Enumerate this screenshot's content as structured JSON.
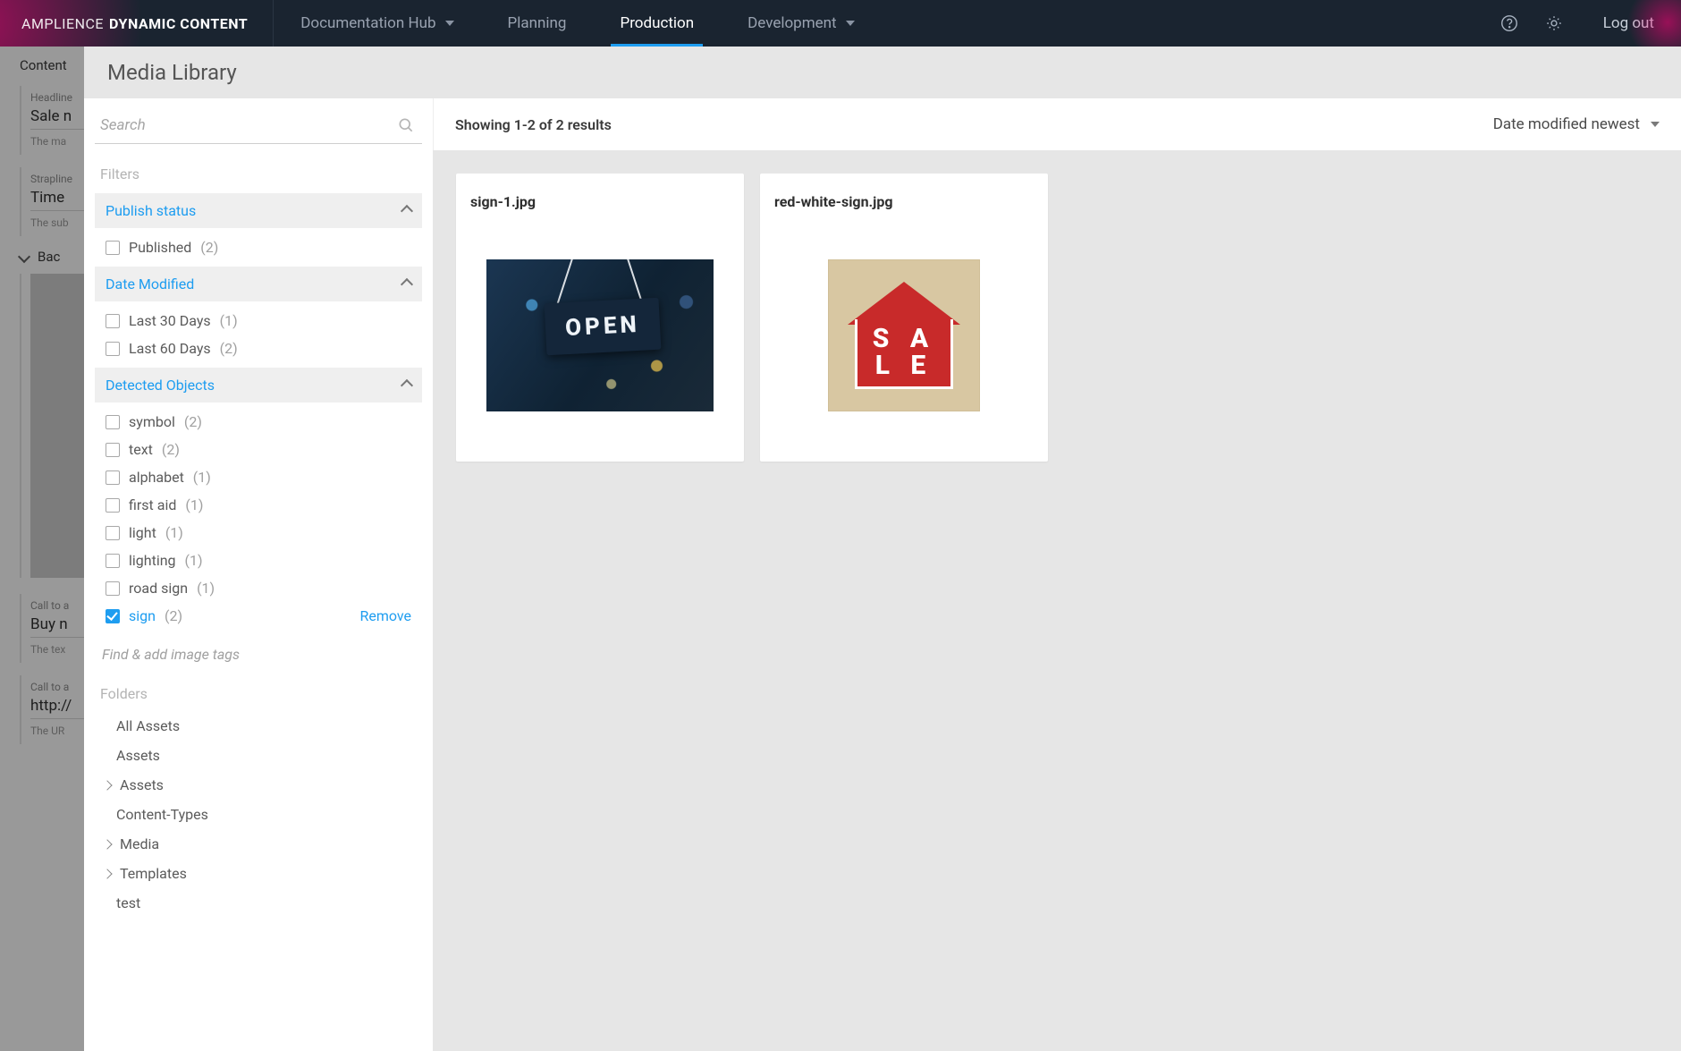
{
  "brand": {
    "part1": "AMPLIENCE",
    "part2": "DYNAMIC CONTENT"
  },
  "nav": {
    "docHub": "Documentation Hub",
    "planning": "Planning",
    "production": "Production",
    "development": "Development",
    "logout": "Log out"
  },
  "backdrop": {
    "contentTab": "Content",
    "headline": {
      "label": "Headline",
      "value": "Sale n",
      "help": "The ma"
    },
    "strap": {
      "label": "Strapline",
      "value": "Time",
      "help": "The sub"
    },
    "bgSection": "Bac",
    "cta": {
      "label": "Call to a",
      "value": "Buy n",
      "help": "The tex"
    },
    "ctaUrl": {
      "label": "Call to a",
      "value": "http://",
      "help": "The UR"
    }
  },
  "mlib": {
    "title": "Media Library",
    "searchPlaceholder": "Search",
    "filtersLabel": "Filters",
    "facets": {
      "publish": {
        "title": "Publish status",
        "options": [
          {
            "label": "Published",
            "count": "(2)"
          }
        ]
      },
      "date": {
        "title": "Date Modified",
        "options": [
          {
            "label": "Last 30 Days",
            "count": "(1)"
          },
          {
            "label": "Last 60 Days",
            "count": "(2)"
          }
        ]
      },
      "detected": {
        "title": "Detected Objects",
        "options": [
          {
            "label": "symbol",
            "count": "(2)"
          },
          {
            "label": "text",
            "count": "(2)"
          },
          {
            "label": "alphabet",
            "count": "(1)"
          },
          {
            "label": "first aid",
            "count": "(1)"
          },
          {
            "label": "light",
            "count": "(1)"
          },
          {
            "label": "lighting",
            "count": "(1)"
          },
          {
            "label": "road sign",
            "count": "(1)"
          },
          {
            "label": "sign",
            "count": "(2)",
            "checked": true
          }
        ],
        "remove": "Remove"
      }
    },
    "tagInputPlaceholder": "Find & add image tags",
    "foldersLabel": "Folders",
    "folders": [
      {
        "label": "All Assets",
        "expandable": false
      },
      {
        "label": "Assets",
        "expandable": false
      },
      {
        "label": "Assets",
        "expandable": true
      },
      {
        "label": "Content-Types",
        "expandable": false
      },
      {
        "label": "Media",
        "expandable": true
      },
      {
        "label": "Templates",
        "expandable": true
      },
      {
        "label": "test",
        "expandable": false
      }
    ],
    "toolbar": {
      "count": "Showing 1-2 of 2 results",
      "sort": "Date modified newest"
    },
    "cards": [
      {
        "title": "sign-1.jpg",
        "art": "open",
        "openText": "OPEN"
      },
      {
        "title": "red-white-sign.jpg",
        "art": "sale",
        "saleLine1": "S A",
        "saleLine2": "L E"
      }
    ]
  }
}
